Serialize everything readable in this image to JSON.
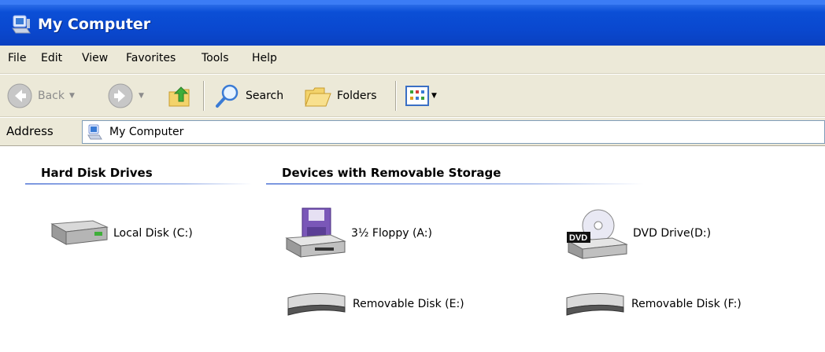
{
  "window": {
    "title": "My Computer",
    "title_icon": "my-computer-icon"
  },
  "menu": {
    "items": [
      {
        "label": "File"
      },
      {
        "label": "Edit"
      },
      {
        "label": "View"
      },
      {
        "label": "Favorites"
      },
      {
        "label": "Tools"
      },
      {
        "label": "Help"
      }
    ]
  },
  "toolbar": {
    "back_label": "Back",
    "search_label": "Search",
    "folders_label": "Folders"
  },
  "address": {
    "label": "Address",
    "value": "My Computer"
  },
  "groups": {
    "hard_disks": {
      "header": "Hard Disk Drives",
      "items": [
        {
          "label": "Local Disk (C:)",
          "icon": "hard-disk-icon"
        }
      ]
    },
    "removable": {
      "header": "Devices with Removable Storage",
      "items": [
        {
          "label": "3½ Floppy (A:)",
          "icon": "floppy-drive-icon"
        },
        {
          "label": "DVD Drive(D:)",
          "icon": "dvd-drive-icon"
        },
        {
          "label": "Removable Disk (E:)",
          "icon": "removable-disk-icon"
        },
        {
          "label": "Removable Disk (F:)",
          "icon": "removable-disk-icon"
        }
      ]
    }
  },
  "colors": {
    "titlebar": "#0a48cf",
    "chrome": "#ece9d8",
    "group_line": "#7a96df"
  }
}
